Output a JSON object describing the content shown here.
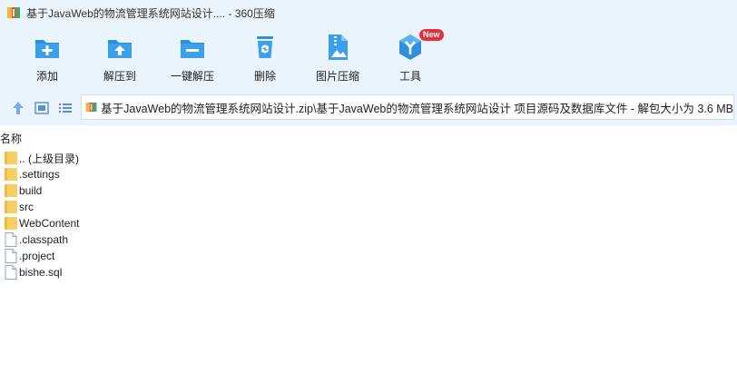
{
  "window": {
    "title": "基于JavaWeb的物流管理系统网站设计.... - 360压缩"
  },
  "toolbar": {
    "buttons": [
      {
        "label": "添加",
        "icon": "add-icon"
      },
      {
        "label": "解压到",
        "icon": "extract-to-icon"
      },
      {
        "label": "一键解压",
        "icon": "one-click-extract-icon"
      },
      {
        "label": "删除",
        "icon": "delete-icon"
      },
      {
        "label": "图片压缩",
        "icon": "image-compress-icon"
      },
      {
        "label": "工具",
        "icon": "tools-icon",
        "badge": "New"
      }
    ]
  },
  "navbar": {
    "address": "基于JavaWeb的物流管理系统网站设计.zip\\基于JavaWeb的物流管理系统网站设计 项目源码及数据库文件 - 解包大小为 3.6 MB"
  },
  "file_list": {
    "column_name": "名称",
    "items": [
      {
        "name": ".. (上级目录)",
        "type": "folder"
      },
      {
        "name": ".settings",
        "type": "folder"
      },
      {
        "name": "build",
        "type": "folder"
      },
      {
        "name": "src",
        "type": "folder"
      },
      {
        "name": "WebContent",
        "type": "folder"
      },
      {
        "name": ".classpath",
        "type": "file"
      },
      {
        "name": ".project",
        "type": "file"
      },
      {
        "name": "bishe.sql",
        "type": "file"
      }
    ]
  },
  "colors": {
    "chrome_bg": "#eaf4fc",
    "icon_blue": "#2f8fdc",
    "folder_yellow": "#f7cf63",
    "badge_red": "#e5303a"
  }
}
